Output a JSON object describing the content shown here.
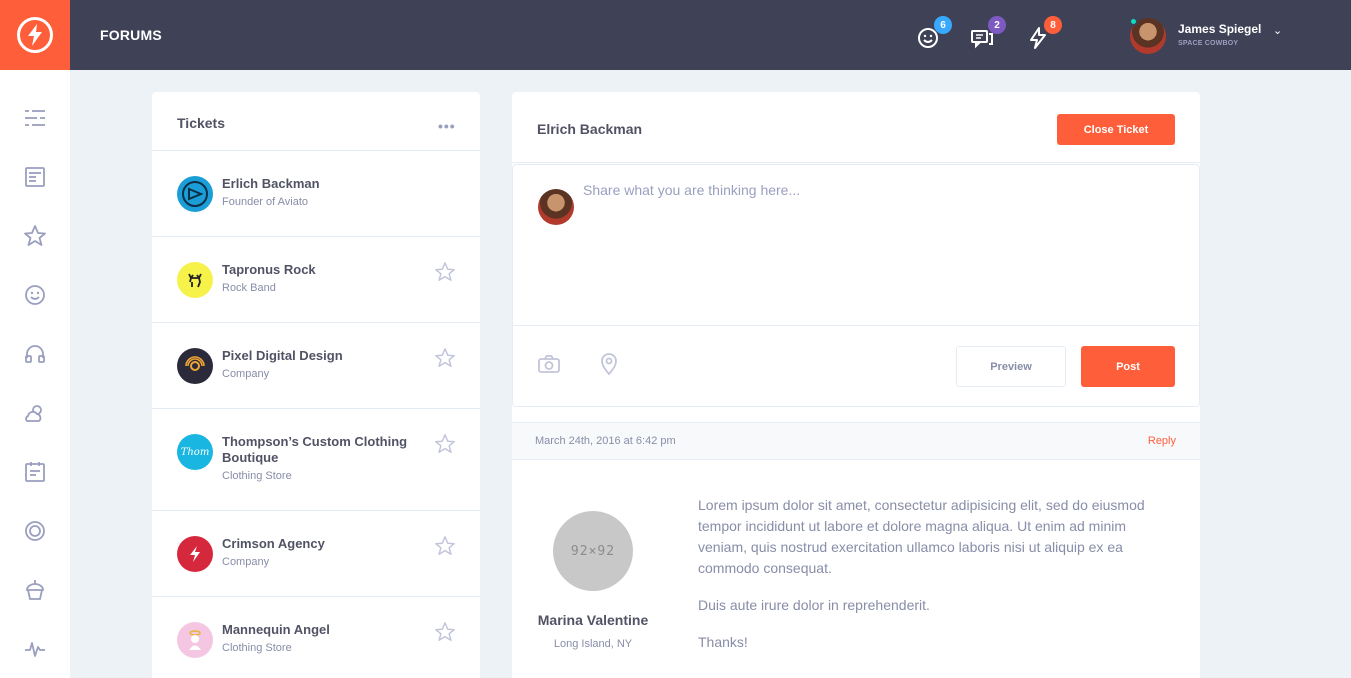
{
  "header": {
    "title": "FORUMS",
    "notifications": [
      {
        "icon": "happy-face-icon",
        "count": "6",
        "color": "#38a9ff"
      },
      {
        "icon": "chat-messages-icon",
        "count": "2",
        "color": "#7c5ac2"
      },
      {
        "icon": "thunder-icon",
        "count": "8",
        "color": "#ff5e3a"
      }
    ],
    "user": {
      "name": "James Spiegel",
      "role": "SPACE COWBOY"
    }
  },
  "sidebar": {
    "items": [
      "menu-icon",
      "newsfeed-icon",
      "star-icon",
      "happy-faces-icon",
      "headphones-icon",
      "weather-icon",
      "calendar-icon",
      "badges-icon",
      "cupcake-icon",
      "stats-icon"
    ]
  },
  "tickets": {
    "title": "Tickets",
    "more": "•••",
    "items": [
      {
        "name": "Erlich Backman",
        "sub": "Founder of Aviato",
        "logo_color": "#1b9ed8"
      },
      {
        "name": "Tapronus Rock",
        "sub": "Rock Band",
        "logo_color": "#f7f249"
      },
      {
        "name": "Pixel Digital Design",
        "sub": "Company",
        "logo_color": "#2a2a3a"
      },
      {
        "name": "Thompson’s Custom Clothing Boutique",
        "sub": "Clothing Store",
        "logo_color": "#19b6e2",
        "logo_text": "Thom"
      },
      {
        "name": "Crimson Agency",
        "sub": "Company",
        "logo_color": "#d6283c"
      },
      {
        "name": "Mannequin Angel",
        "sub": "Clothing Store",
        "logo_color": "#f5c6e1"
      }
    ]
  },
  "conversation": {
    "title": "Elrich Backman",
    "close_label": "Close Ticket",
    "composer": {
      "placeholder": "Share what you are thinking here...",
      "preview_label": "Preview",
      "post_label": "Post"
    },
    "post": {
      "date": "March 24th, 2016 at 6:42 pm",
      "reply_label": "Reply",
      "avatar_placeholder": "92×92",
      "author": "Marina Valentine",
      "location": "Long Island, NY",
      "paragraphs": [
        "Lorem ipsum dolor sit amet, consectetur adipisicing elit, sed do eiusmod tempor incididunt ut labore et dolore magna aliqua. Ut enim ad minim veniam, quis nostrud exercitation ullamco laboris nisi ut aliquip ex ea commodo consequat.",
        "Duis aute irure dolor in reprehenderit.",
        "Thanks!"
      ]
    }
  },
  "colors": {
    "accent": "#ff5e3a",
    "header_bg": "#3f4257",
    "page_bg": "#edf2f6"
  }
}
